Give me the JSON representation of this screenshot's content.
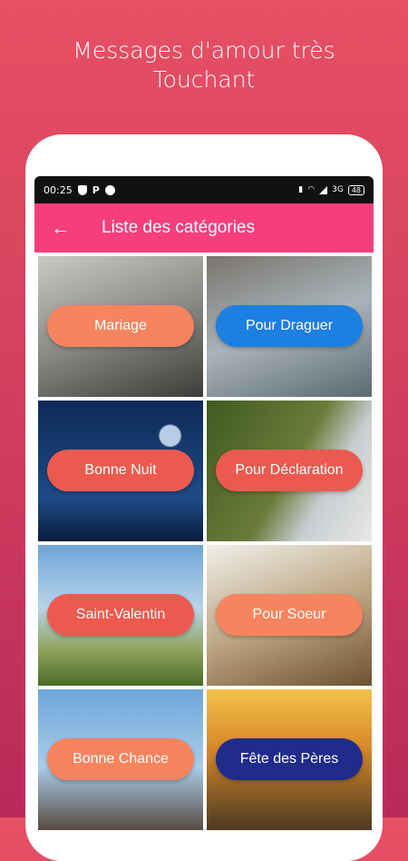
{
  "promo": {
    "title_line1": "Messages d'amour très",
    "title_line2": "Touchant"
  },
  "status_bar": {
    "time": "00:25",
    "p_icon": "P",
    "network": "3G",
    "battery": "48"
  },
  "app_bar": {
    "back_icon": "←",
    "title": "Liste des catégories"
  },
  "categories": [
    {
      "label": "Mariage",
      "color": "#f6845e"
    },
    {
      "label": "Pour Draguer",
      "color": "#1d7fdf"
    },
    {
      "label": "Bonne Nuit",
      "color": "#ec5a4f"
    },
    {
      "label": "Pour Déclaration",
      "color": "#ec5a4f"
    },
    {
      "label": "Saint-Valentin",
      "color": "#ec5a4f"
    },
    {
      "label": "Pour Soeur",
      "color": "#f6845e"
    },
    {
      "label": "Bonne Chance",
      "color": "#f6845e"
    },
    {
      "label": "Fête des Pères",
      "color": "#1f2c8a"
    }
  ],
  "colors": {
    "app_bar": "#f53e7b",
    "background_top": "#e65064",
    "background_bottom": "#b92a5a"
  }
}
